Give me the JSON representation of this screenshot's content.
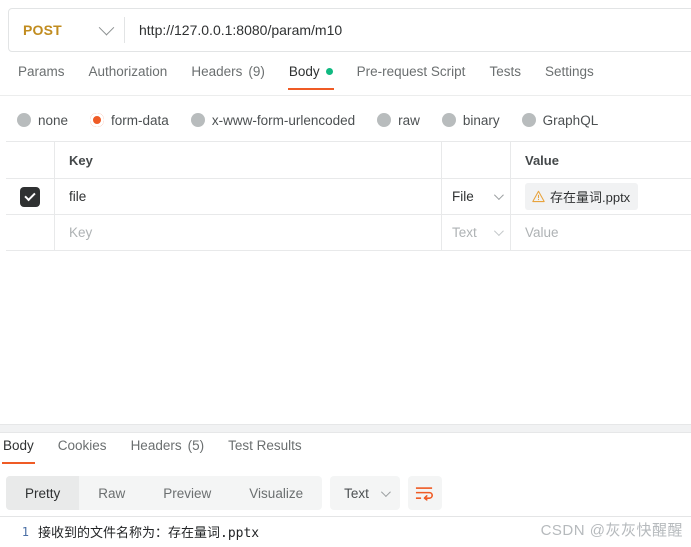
{
  "request_bar": {
    "method": "POST",
    "method_caret_icon": "chevron-down-icon",
    "url": "http://127.0.0.1:8080/param/m10"
  },
  "request_tabs": [
    {
      "label": "Params",
      "active": false
    },
    {
      "label": "Authorization",
      "active": false
    },
    {
      "label": "Headers",
      "count": "(9)",
      "active": false
    },
    {
      "label": "Body",
      "active": true,
      "dot": true
    },
    {
      "label": "Pre-request Script",
      "active": false
    },
    {
      "label": "Tests",
      "active": false
    },
    {
      "label": "Settings",
      "active": false
    }
  ],
  "body_types": [
    {
      "label": "none",
      "selected": false
    },
    {
      "label": "form-data",
      "selected": true
    },
    {
      "label": "x-www-form-urlencoded",
      "selected": false
    },
    {
      "label": "raw",
      "selected": false
    },
    {
      "label": "binary",
      "selected": false
    },
    {
      "label": "GraphQL",
      "selected": false
    }
  ],
  "kv_table": {
    "headers": {
      "key": "Key",
      "value": "Value"
    },
    "rows": [
      {
        "checked": true,
        "key": "file",
        "type": "File",
        "value_chip": "存在量词.pptx",
        "value_icon": "warning-triangle-icon",
        "placeholder": false
      },
      {
        "checked": false,
        "key": "Key",
        "type": "Text",
        "value_chip": "Value",
        "placeholder": true
      }
    ]
  },
  "response_tabs": [
    {
      "label": "Body",
      "active": true
    },
    {
      "label": "Cookies",
      "active": false
    },
    {
      "label": "Headers",
      "count": "(5)",
      "active": false
    },
    {
      "label": "Test Results",
      "active": false
    }
  ],
  "response_toolbar": {
    "view_modes": [
      {
        "label": "Pretty",
        "active": true
      },
      {
        "label": "Raw",
        "active": false
      },
      {
        "label": "Preview",
        "active": false
      },
      {
        "label": "Visualize",
        "active": false
      }
    ],
    "format": "Text",
    "format_caret_icon": "chevron-down-icon",
    "wrap_button_icon": "wrap-text-icon"
  },
  "response_body": {
    "lines": [
      {
        "number": "1",
        "text": "接收到的文件名称为：存在量词.pptx"
      }
    ]
  },
  "watermark": "CSDN @灰灰快醒醒",
  "colors": {
    "accent": "#ef5b25",
    "method": "#c18c1f",
    "dot_green": "#10b981",
    "warning": "#e8a33d"
  }
}
